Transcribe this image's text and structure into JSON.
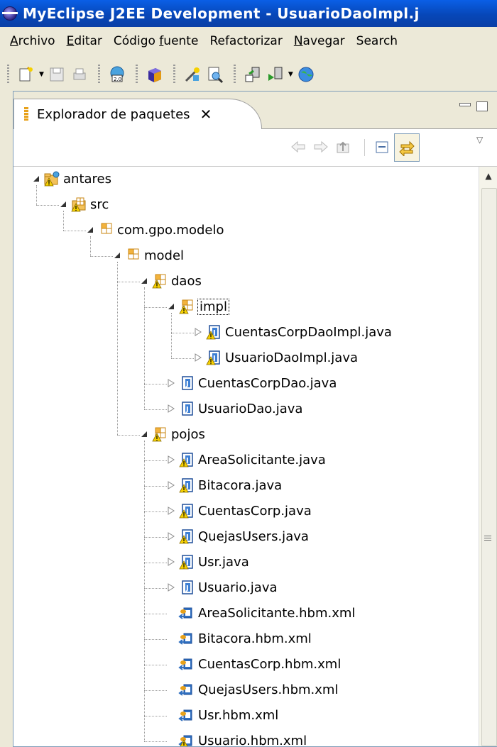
{
  "window": {
    "title": "MyEclipse J2EE Development - UsuarioDaoImpl.j"
  },
  "menu": [
    {
      "label": "Archivo",
      "key": "A"
    },
    {
      "label": "Editar",
      "key": "E"
    },
    {
      "label": "Código fuente",
      "key": "f"
    },
    {
      "label": "Refactorizar",
      "key": ""
    },
    {
      "label": "Navegar",
      "key": "N"
    },
    {
      "label": "Search",
      "key": ""
    }
  ],
  "view": {
    "tab_label": "Explorador de paquetes",
    "close_symbol": "✕"
  },
  "tree": [
    {
      "label": "antares",
      "type": "project",
      "depth": 0,
      "expanded": true
    },
    {
      "label": "src",
      "type": "srcfolder",
      "depth": 1,
      "expanded": true
    },
    {
      "label": "com.gpo.modelo",
      "type": "package",
      "depth": 2,
      "expanded": true
    },
    {
      "label": "model",
      "type": "package",
      "depth": 3,
      "expanded": true
    },
    {
      "label": "daos",
      "type": "package-warn",
      "depth": 4,
      "expanded": true
    },
    {
      "label": "impl",
      "type": "package-warn",
      "depth": 5,
      "expanded": true,
      "focused": true
    },
    {
      "label": "CuentasCorpDaoImpl.java",
      "type": "java-warn",
      "depth": 6,
      "expanded": false
    },
    {
      "label": "UsuarioDaoImpl.java",
      "type": "java-warn",
      "depth": 6,
      "expanded": false
    },
    {
      "label": "CuentasCorpDao.java",
      "type": "java",
      "depth": 5,
      "expanded": false
    },
    {
      "label": "UsuarioDao.java",
      "type": "java",
      "depth": 5,
      "expanded": false
    },
    {
      "label": "pojos",
      "type": "package-warn",
      "depth": 4,
      "expanded": true
    },
    {
      "label": "AreaSolicitante.java",
      "type": "java-warn",
      "depth": 5,
      "expanded": false
    },
    {
      "label": "Bitacora.java",
      "type": "java-warn",
      "depth": 5,
      "expanded": false
    },
    {
      "label": "CuentasCorp.java",
      "type": "java-warn",
      "depth": 5,
      "expanded": false
    },
    {
      "label": "QuejasUsers.java",
      "type": "java-warn",
      "depth": 5,
      "expanded": false
    },
    {
      "label": "Usr.java",
      "type": "java-warn",
      "depth": 5,
      "expanded": false
    },
    {
      "label": "Usuario.java",
      "type": "java",
      "depth": 5,
      "expanded": false
    },
    {
      "label": "AreaSolicitante.hbm.xml",
      "type": "hbm",
      "depth": 5
    },
    {
      "label": "Bitacora.hbm.xml",
      "type": "hbm",
      "depth": 5
    },
    {
      "label": "CuentasCorp.hbm.xml",
      "type": "hbm",
      "depth": 5
    },
    {
      "label": "QuejasUsers.hbm.xml",
      "type": "hbm",
      "depth": 5
    },
    {
      "label": "Usr.hbm.xml",
      "type": "hbm",
      "depth": 5
    },
    {
      "label": "Usuario.hbm.xml",
      "type": "hbm-warn",
      "depth": 5
    }
  ],
  "colors": {
    "title_bar": "#0747b8",
    "package_orange": "#e7a11a",
    "java_blue": "#1f4f9a",
    "warning_yellow": "#f5d000"
  }
}
